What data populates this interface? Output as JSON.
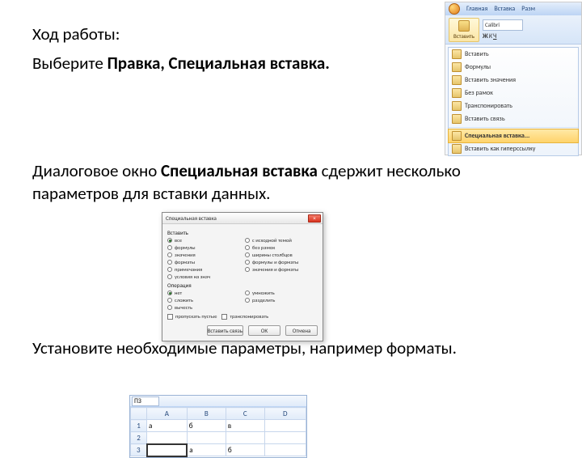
{
  "text": {
    "title": "Ход работы:",
    "p2_a": "Выберите ",
    "p2_b": "Правка, Специальная вставка.",
    "p3_a": "Диалоговое окно ",
    "p3_b": "Специальная вставка ",
    "p3_c": "сдержит несколько параметров для вставки данных.",
    "p4": "Установите необходимые параметры, например форматы."
  },
  "ribbon": {
    "tab_home": "Главная",
    "tab_insert": "Вставка",
    "tab_page": "Разм",
    "paste_label": "Вставить",
    "font": "Calibri",
    "menu_items": [
      "Вставить",
      "Формулы",
      "Вставить значения",
      "Без рамок",
      "Транспонировать",
      "Вставить связь"
    ],
    "menu_hl": "Специальная вставка...",
    "menu_last": "Вставить как гиперссылку"
  },
  "dialog": {
    "title": "Специальная вставка",
    "g1": "Вставить",
    "left1": [
      "все",
      "формулы",
      "значения",
      "форматы",
      "примечания",
      "условия на знач"
    ],
    "right1": [
      "с исходной темой",
      "без рамок",
      "ширины столбцов",
      "формулы и форматы",
      "значения и форматы"
    ],
    "g2": "Операция",
    "left2": [
      "нет",
      "сложить",
      "вычесть"
    ],
    "right2": [
      "умножить",
      "разделить"
    ],
    "chk1": "пропускать пустые",
    "chk2": "транспонировать",
    "ok": "ОК",
    "cancel": "Отмена",
    "link": "Вставить связь"
  },
  "sheet": {
    "namebox": "ПЗ",
    "cols": [
      "A",
      "B",
      "C",
      "D"
    ],
    "rows": [
      [
        "а",
        "б",
        "в",
        ""
      ],
      [
        "",
        "",
        "",
        ""
      ],
      [
        "",
        "а",
        "б",
        ""
      ]
    ]
  }
}
